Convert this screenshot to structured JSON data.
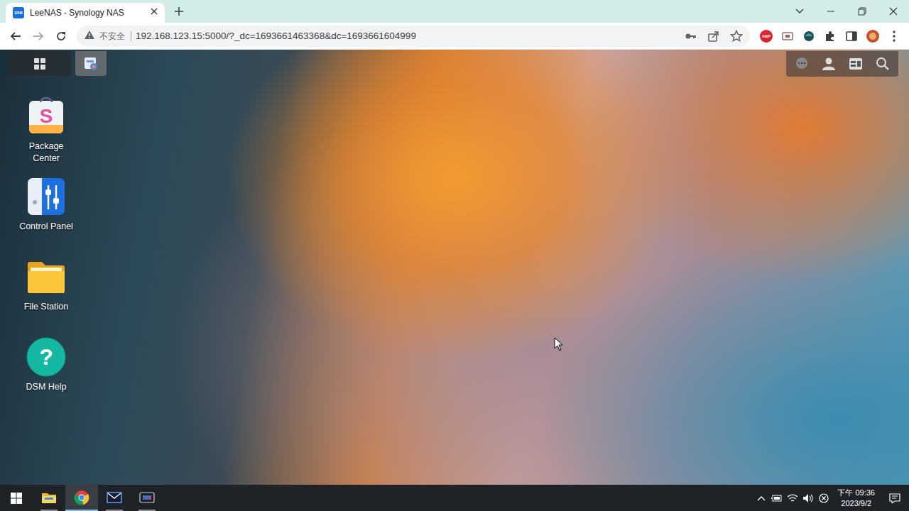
{
  "browser": {
    "tab": {
      "favicon": "DSM",
      "title": "LeeNAS - Synology NAS",
      "selected": true
    },
    "address": {
      "security": "不安全",
      "url": "192.168.123.15:5000/?_dc=1693661463368&dc=1693661604999"
    },
    "extensions": [
      {
        "label": "ABP"
      }
    ]
  },
  "dsm_topbar": [
    {
      "kind": "main-menu",
      "selected": false
    },
    {
      "kind": "app-window",
      "selected": true
    }
  ],
  "desktop_icons": [
    {
      "label": "Package Center",
      "kind": "package",
      "glyph": "S"
    },
    {
      "label": "Control Panel",
      "kind": "control",
      "glyph": ""
    },
    {
      "label": "File Station",
      "kind": "folder",
      "glyph": ""
    },
    {
      "label": "DSM Help",
      "kind": "help",
      "glyph": "?"
    }
  ],
  "taskbar": {
    "apps": [
      {
        "kind": "explorer",
        "active": false
      },
      {
        "kind": "chrome",
        "active": true
      },
      {
        "kind": "mail",
        "active": false
      },
      {
        "kind": "remote",
        "active": false
      }
    ],
    "time": "下午 09:36",
    "date": "2023/9/2"
  }
}
